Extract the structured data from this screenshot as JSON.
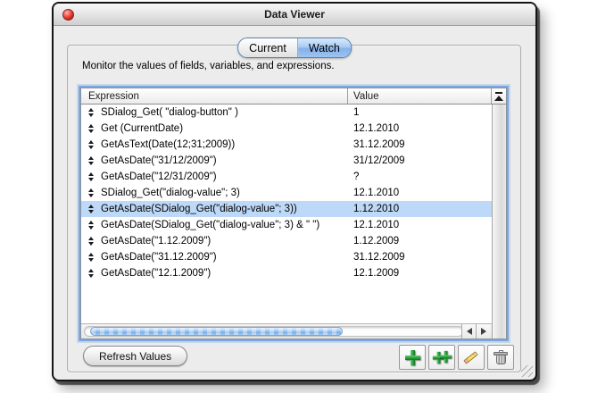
{
  "window": {
    "title": "Data Viewer"
  },
  "tabs": [
    {
      "label": "Current",
      "selected": false
    },
    {
      "label": "Watch",
      "selected": true
    }
  ],
  "description": "Monitor the values of fields, variables, and expressions.",
  "table": {
    "columns": [
      "Expression",
      "Value"
    ],
    "selection_color": "#BDD9F7",
    "rows": [
      {
        "expression": "SDialog_Get( \"dialog-button\" )",
        "value": "1",
        "selected": false
      },
      {
        "expression": "Get (CurrentDate)",
        "value": "12.1.2010",
        "selected": false
      },
      {
        "expression": "GetAsText(Date(12;31;2009))",
        "value": "31.12.2009",
        "selected": false
      },
      {
        "expression": "GetAsDate(\"31/12/2009\")",
        "value": "31/12/2009",
        "selected": false
      },
      {
        "expression": "GetAsDate(\"12/31/2009\")",
        "value": "?",
        "selected": false
      },
      {
        "expression": "SDialog_Get(\"dialog-value\"; 3)",
        "value": "12.1.2010",
        "selected": false
      },
      {
        "expression": "GetAsDate(SDialog_Get(\"dialog-value\"; 3))",
        "value": "1.12.2010",
        "selected": true
      },
      {
        "expression": "GetAsDate(SDialog_Get(\"dialog-value\"; 3) & \" \")",
        "value": "12.1.2010",
        "selected": false
      },
      {
        "expression": "GetAsDate(\"1.12.2009\")",
        "value": "1.12.2009",
        "selected": false
      },
      {
        "expression": "GetAsDate(\"31.12.2009\")",
        "value": "31.12.2009",
        "selected": false
      },
      {
        "expression": "GetAsDate(\"12.1.2009\")",
        "value": "12.1.2009",
        "selected": false
      }
    ]
  },
  "toolbar": {
    "refresh_label": "Refresh Values",
    "icon_buttons": [
      {
        "name": "add-expression-button",
        "icon": "plus-icon"
      },
      {
        "name": "add-multiple-expressions-button",
        "icon": "double-plus-icon"
      },
      {
        "name": "edit-expression-button",
        "icon": "pencil-icon"
      },
      {
        "name": "delete-expression-button",
        "icon": "trash-icon"
      }
    ]
  },
  "colors": {
    "selection": "#BDD9F7",
    "tab_active": "#8DB9EC",
    "scrollbar_thumb": "#8FC0F0",
    "plus_green": "#2E9E3E",
    "close_red": "#E8352C"
  }
}
